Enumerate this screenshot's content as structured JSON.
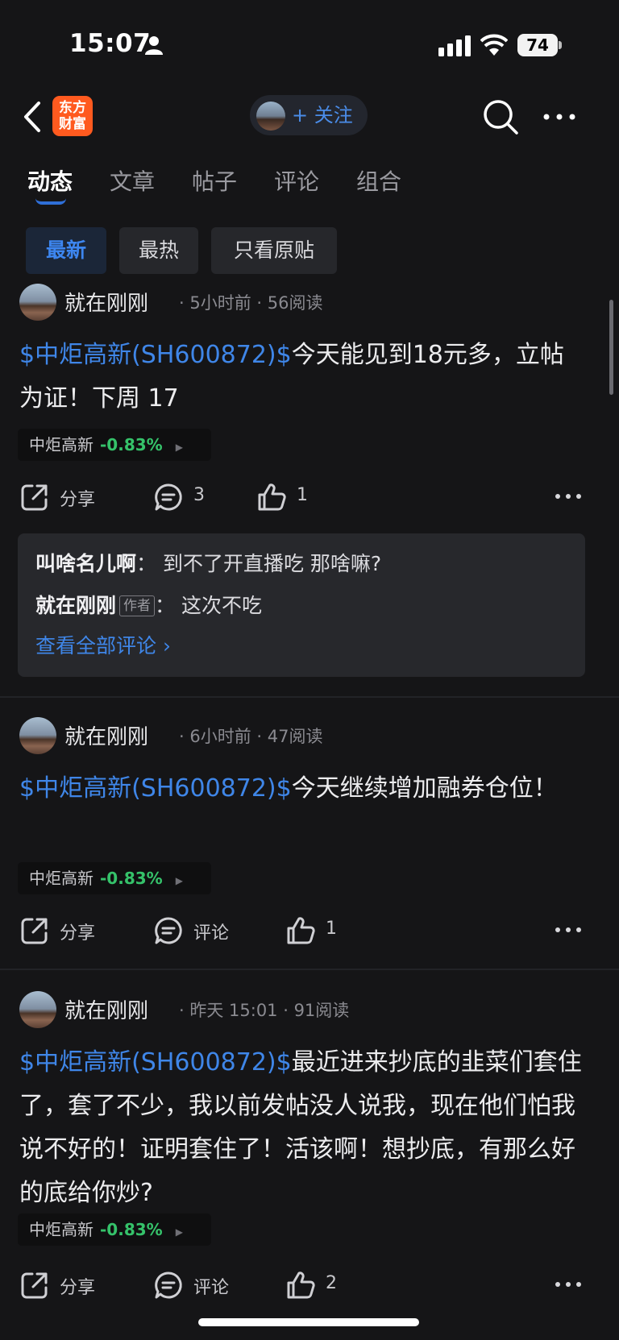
{
  "status_bar": {
    "time": "15:07",
    "battery": "74"
  },
  "nav": {
    "logo_line1": "东方",
    "logo_line2": "财富",
    "follow_label": "+ 关注"
  },
  "tabs": [
    {
      "label": "动态"
    },
    {
      "label": "文章"
    },
    {
      "label": "帖子"
    },
    {
      "label": "评论"
    },
    {
      "label": "组合"
    }
  ],
  "filters": [
    {
      "label": "最新"
    },
    {
      "label": "最热"
    },
    {
      "label": "只看原贴"
    }
  ],
  "posts": [
    {
      "author": "就在刚刚",
      "meta": "· 5小时前 · 56阅读",
      "stock_link": "$中炬高新(SH600872)$",
      "text": "今天能见到18元多，立帖为证！下周  17",
      "chip_name": "中炬高新",
      "chip_change": "-0.83%",
      "share": "分享",
      "comment": "3",
      "like": "1",
      "comments": {
        "c1_user": "叫啥名儿啊",
        "c1_text": "：  到不了开直播吃 那啥嘛?",
        "c2_user": "就在刚刚",
        "c2_tag": "作者",
        "c2_text": "：  这次不吃",
        "view_all": "查看全部评论 ›"
      }
    },
    {
      "author": "就在刚刚",
      "meta": "· 6小时前 · 47阅读",
      "stock_link": "$中炬高新(SH600872)$",
      "text": "今天继续增加融券仓位！",
      "chip_name": "中炬高新",
      "chip_change": "-0.83%",
      "share": "分享",
      "comment": "评论",
      "like": "1"
    },
    {
      "author": "就在刚刚",
      "meta": "· 昨天 15:01 · 91阅读",
      "stock_link": "$中炬高新(SH600872)$",
      "text": "最近进来抄底的韭菜们套住了，套了不少，我以前发帖没人说我，现在他们怕我说不好的！证明套住了！活该啊！想抄底，有那么好的底给你炒?",
      "chip_name": "中炬高新",
      "chip_change": "-0.83%",
      "share": "分享",
      "comment": "评论",
      "like": "2"
    }
  ]
}
